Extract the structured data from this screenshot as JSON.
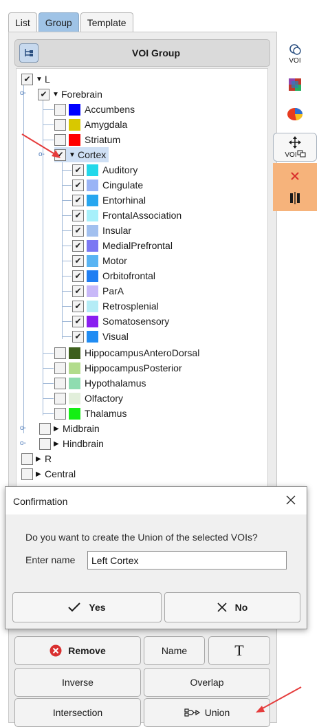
{
  "tabs": [
    {
      "label": "List",
      "active": false
    },
    {
      "label": "Group",
      "active": true
    },
    {
      "label": "Template",
      "active": false
    }
  ],
  "voi_group": {
    "title": "VOI Group",
    "header_icon": "tree-structure-icon"
  },
  "tree": {
    "L": {
      "label": "L",
      "checked": true,
      "expanded": true
    },
    "forebrain": {
      "label": "Forebrain",
      "checked": true,
      "expanded": true
    },
    "accumbens": {
      "label": "Accumbens",
      "checked": false,
      "color": "#0000ff"
    },
    "amygdala": {
      "label": "Amygdala",
      "checked": false,
      "color": "#d8c800"
    },
    "striatum": {
      "label": "Striatum",
      "checked": false,
      "color": "#ff0000"
    },
    "cortex": {
      "label": "Cortex",
      "checked": true,
      "expanded": true,
      "selected": true
    },
    "cortex_children": [
      {
        "label": "Auditory",
        "checked": true,
        "color": "#22d8ea"
      },
      {
        "label": "Cingulate",
        "checked": true,
        "color": "#9ab4f6"
      },
      {
        "label": "Entorhinal",
        "checked": true,
        "color": "#27a6ef"
      },
      {
        "label": "FrontalAssociation",
        "checked": true,
        "color": "#a7f0fb"
      },
      {
        "label": "Insular",
        "checked": true,
        "color": "#a2c0ef"
      },
      {
        "label": "MedialPrefrontal",
        "checked": true,
        "color": "#7b78f3"
      },
      {
        "label": "Motor",
        "checked": true,
        "color": "#59b4f3"
      },
      {
        "label": "Orbitofrontal",
        "checked": true,
        "color": "#1f7ef2"
      },
      {
        "label": "ParA",
        "checked": true,
        "color": "#c8b8f8"
      },
      {
        "label": "Retrosplenial",
        "checked": true,
        "color": "#b4ecf6"
      },
      {
        "label": "Somatosensory",
        "checked": true,
        "color": "#8a1ef0"
      },
      {
        "label": "Visual",
        "checked": true,
        "color": "#208cf3"
      }
    ],
    "forebrain_more": [
      {
        "label": "HippocampusAnteroDorsal",
        "checked": false,
        "color": "#3d5f1c"
      },
      {
        "label": "HippocampusPosterior",
        "checked": false,
        "color": "#b2dc8c"
      },
      {
        "label": "Hypothalamus",
        "checked": false,
        "color": "#8fdcb0"
      },
      {
        "label": "Olfactory",
        "checked": false,
        "color": "#e2efdb"
      },
      {
        "label": "Thalamus",
        "checked": false,
        "color": "#14ef14"
      }
    ],
    "midbrain": {
      "label": "Midbrain",
      "checked": false,
      "expanded": false
    },
    "hindbrain": {
      "label": "Hindbrain",
      "checked": false,
      "expanded": false
    },
    "R": {
      "label": "R",
      "checked": false,
      "expanded": false
    },
    "central": {
      "label": "Central",
      "checked": false,
      "expanded": false
    }
  },
  "side_toolbar": {
    "voi_label": "VOI",
    "move_voi_label": "VOI",
    "items": [
      "voi-icon",
      "color-grid-icon",
      "pie-3d-icon",
      "move-voi-icon",
      "delete-icon",
      "distribute-icon"
    ]
  },
  "dialog": {
    "title": "Confirmation",
    "question": "Do you want to create the Union of the selected VOIs?",
    "name_label": "Enter name",
    "name_value": "Left Cortex",
    "yes_label": "Yes",
    "no_label": "No"
  },
  "buttons": {
    "remove": "Remove",
    "name": "Name",
    "text_tool": "T",
    "inverse": "Inverse",
    "overlap": "Overlap",
    "intersection": "Intersection",
    "union": "Union"
  },
  "colors": {
    "active_tab": "#9fc3e6",
    "selection": "#cfe0f5",
    "annotation_arrow": "#e53c3c",
    "remove_icon": "#d93030",
    "orange_toolbar": "#f6b37b"
  }
}
